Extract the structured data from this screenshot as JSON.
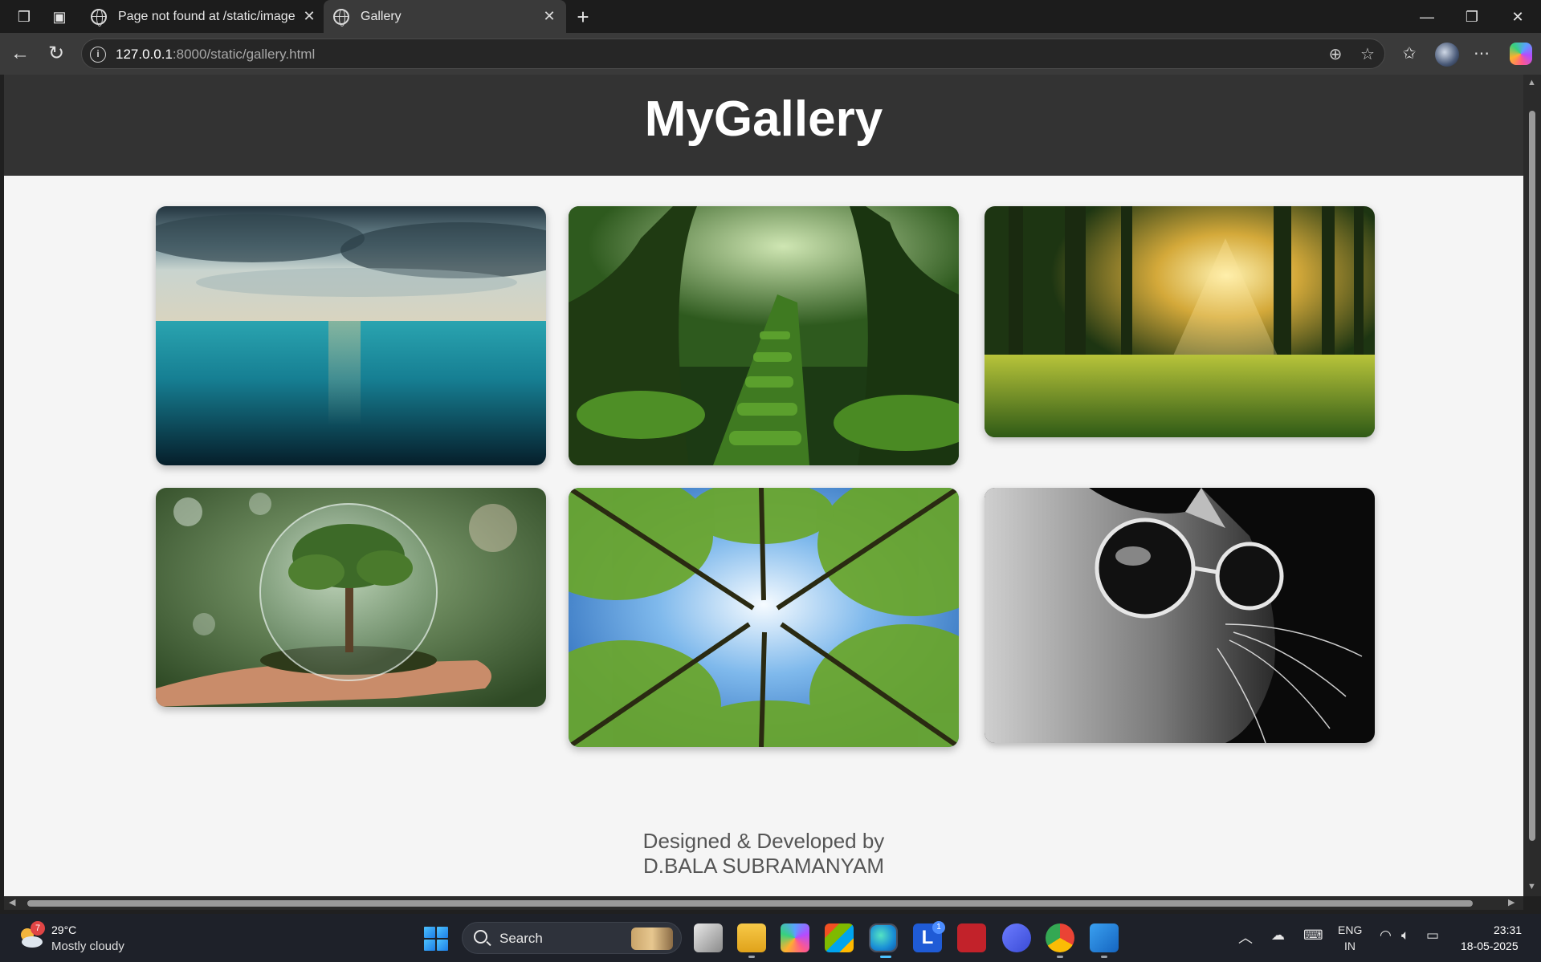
{
  "browser": {
    "tabs": [
      {
        "title": "Page not found at /static/image_c"
      },
      {
        "title": "Gallery"
      }
    ],
    "url_host": "127.0.0.1",
    "url_rest": ":8000/static/gallery.html"
  },
  "page": {
    "title": "MyGallery",
    "footer_line1": "Designed & Developed by",
    "footer_line2": "D.BALA SUBRAMANYAM",
    "background": "#f5f5f5",
    "header_background": "#333333"
  },
  "gallery": {
    "images": [
      {
        "name": "ocean-sunset-image"
      },
      {
        "name": "mossy-forest-stairs-image"
      },
      {
        "name": "sunlit-forest-image"
      },
      {
        "name": "tree-in-glass-globe-image"
      },
      {
        "name": "forest-canopy-image"
      },
      {
        "name": "cat-with-sunglasses-image"
      }
    ]
  },
  "taskbar": {
    "weather_temp": "29°C",
    "weather_desc": "Mostly cloudy",
    "weather_badge": "7",
    "search_label": "Search",
    "lang_line1": "ENG",
    "lang_line2": "IN",
    "time": "23:31",
    "date": "18-05-2025",
    "linkedin_badge": "1"
  }
}
